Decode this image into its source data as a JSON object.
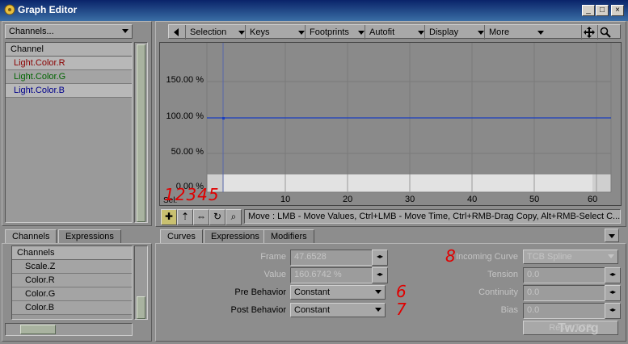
{
  "window": {
    "title": "Graph Editor",
    "controls": [
      "_",
      "□",
      "×"
    ]
  },
  "left": {
    "channels_dropdown": "Channels...",
    "channel_list": {
      "header": "Channel",
      "items": [
        {
          "label": "Light.Color.R",
          "color": "#8b0000"
        },
        {
          "label": "Light.Color.G",
          "color": "#006400"
        },
        {
          "label": "Light.Color.B",
          "color": "#00008b"
        }
      ]
    },
    "tabs": [
      "Channels",
      "Expressions"
    ],
    "bottom_list": {
      "header": "Channels",
      "items": [
        "Scale.Z",
        "Color.R",
        "Color.G",
        "Color.B"
      ]
    }
  },
  "menubar": {
    "items": [
      "Selection",
      "Keys",
      "Footprints",
      "Autofit",
      "Display",
      "More"
    ]
  },
  "graph": {
    "y_labels": [
      "150.00 %",
      "100.00 %",
      "50.00 %",
      "0.00 %"
    ],
    "x_labels": [
      "10",
      "20",
      "30",
      "40",
      "50",
      "60"
    ],
    "sel_label": "Sel:",
    "curve_color": "#1a3fbf"
  },
  "toolbar": {
    "status": "Move : LMB - Move Values, Ctrl+LMB - Move Time, Ctrl+RMB-Drag Copy, Alt+RMB-Select C..."
  },
  "lower_tabs": [
    "Curves",
    "Expressions",
    "Modifiers"
  ],
  "fields": {
    "frame_label": "Frame",
    "frame_value": "47.6528",
    "value_label": "Value",
    "value_value": "160.6742 %",
    "pre_label": "Pre Behavior",
    "pre_value": "Constant",
    "post_label": "Post Behavior",
    "post_value": "Constant",
    "incoming_label": "Incoming Curve",
    "incoming_value": "TCB Spline",
    "tension_label": "Tension",
    "tension_value": "0.0",
    "continuity_label": "Continuity",
    "continuity_value": "0.0",
    "bias_label": "Bias",
    "bias_value": "0.0",
    "reset_label": "Reset TCB"
  },
  "annotations": {
    "tools": "12345",
    "six": "6",
    "seven": "7",
    "eight": "8"
  },
  "watermark": "Tw.org"
}
